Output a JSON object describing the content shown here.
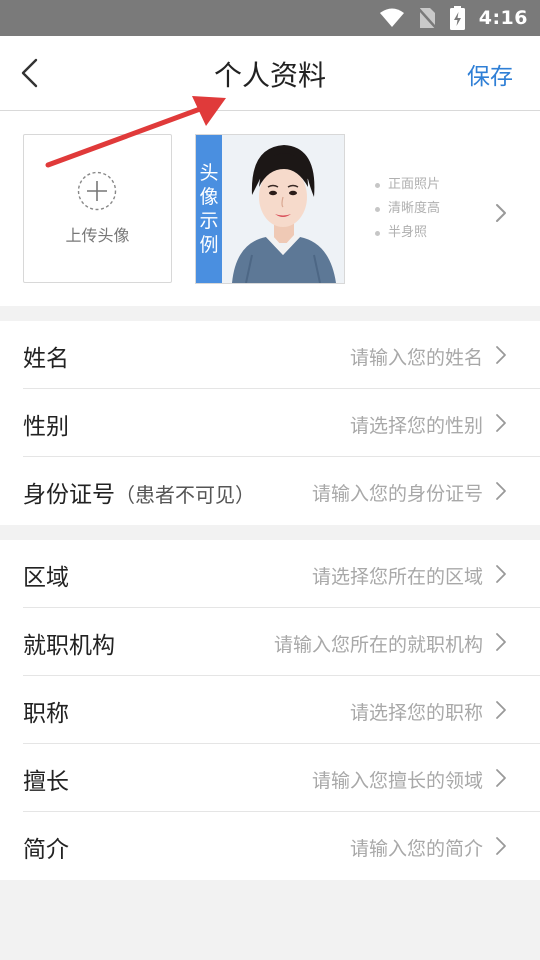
{
  "status_bar": {
    "time": "4:16",
    "icons": [
      "wifi-icon",
      "no-sim-icon",
      "battery-charging-icon"
    ]
  },
  "header": {
    "back_icon": "back-chevron-icon",
    "title": "个人资料",
    "save_label": "保存"
  },
  "avatar": {
    "upload_label": "上传头像",
    "example_label": [
      "头",
      "像",
      "示",
      "例"
    ],
    "tips": [
      "正面照片",
      "清晰度高",
      "半身照"
    ]
  },
  "form_groups": [
    {
      "rows": [
        {
          "label": "姓名",
          "note": "",
          "placeholder": "请输入您的姓名"
        },
        {
          "label": "性别",
          "note": "",
          "placeholder": "请选择您的性别"
        },
        {
          "label": "身份证号",
          "note": "（患者不可见）",
          "placeholder": "请输入您的身份证号"
        }
      ]
    },
    {
      "rows": [
        {
          "label": "区域",
          "note": "",
          "placeholder": "请选择您所在的区域"
        },
        {
          "label": "就职机构",
          "note": "",
          "placeholder": "请输入您所在的就职机构"
        },
        {
          "label": "职称",
          "note": "",
          "placeholder": "请选择您的职称"
        },
        {
          "label": "擅长",
          "note": "",
          "placeholder": "请输入您擅长的领域"
        },
        {
          "label": "简介",
          "note": "",
          "placeholder": "请输入您的简介"
        }
      ]
    }
  ],
  "colors": {
    "accent": "#2f7fd6",
    "example_band": "#4a8fe0",
    "annotation_arrow": "#e03a3a",
    "status_bar": "#7a7a7a"
  }
}
